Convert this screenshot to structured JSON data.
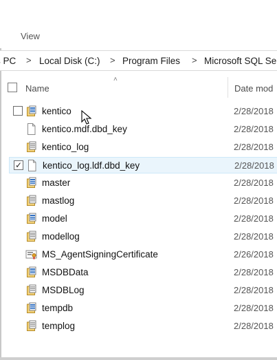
{
  "ribbon": {
    "view_tab": "View"
  },
  "address": {
    "crumbs": [
      "s PC",
      "Local Disk (C:)",
      "Program Files",
      "Microsoft SQL Se"
    ],
    "separator": ">"
  },
  "columns": {
    "name": "Name",
    "date": "Date mod"
  },
  "files": [
    {
      "name": "kentico",
      "date": "2/28/2018",
      "type": "sql-data-file",
      "checkbox": "unchecked-visible"
    },
    {
      "name": "kentico.mdf.dbd_key",
      "date": "2/28/2018",
      "type": "generic-file",
      "checkbox": "hidden"
    },
    {
      "name": "kentico_log",
      "date": "2/28/2018",
      "type": "sql-log-file",
      "checkbox": "hidden"
    },
    {
      "name": "kentico_log.ldf.dbd_key",
      "date": "2/28/2018",
      "type": "generic-file",
      "checkbox": "checked",
      "selected": true
    },
    {
      "name": "master",
      "date": "2/28/2018",
      "type": "sql-data-file",
      "checkbox": "hidden"
    },
    {
      "name": "mastlog",
      "date": "2/28/2018",
      "type": "sql-log-file",
      "checkbox": "hidden"
    },
    {
      "name": "model",
      "date": "2/28/2018",
      "type": "sql-data-file",
      "checkbox": "hidden"
    },
    {
      "name": "modellog",
      "date": "2/28/2018",
      "type": "sql-log-file",
      "checkbox": "hidden"
    },
    {
      "name": "MS_AgentSigningCertificate",
      "date": "2/26/2018",
      "type": "certificate-file",
      "checkbox": "hidden"
    },
    {
      "name": "MSDBData",
      "date": "2/28/2018",
      "type": "sql-data-file",
      "checkbox": "hidden"
    },
    {
      "name": "MSDBLog",
      "date": "2/28/2018",
      "type": "sql-log-file",
      "checkbox": "hidden"
    },
    {
      "name": "tempdb",
      "date": "2/28/2018",
      "type": "sql-data-file",
      "checkbox": "hidden"
    },
    {
      "name": "templog",
      "date": "2/28/2018",
      "type": "sql-log-file",
      "checkbox": "hidden"
    }
  ],
  "colors": {
    "selection_bg": "#eaf5fc",
    "selection_border": "#cde8f9"
  }
}
